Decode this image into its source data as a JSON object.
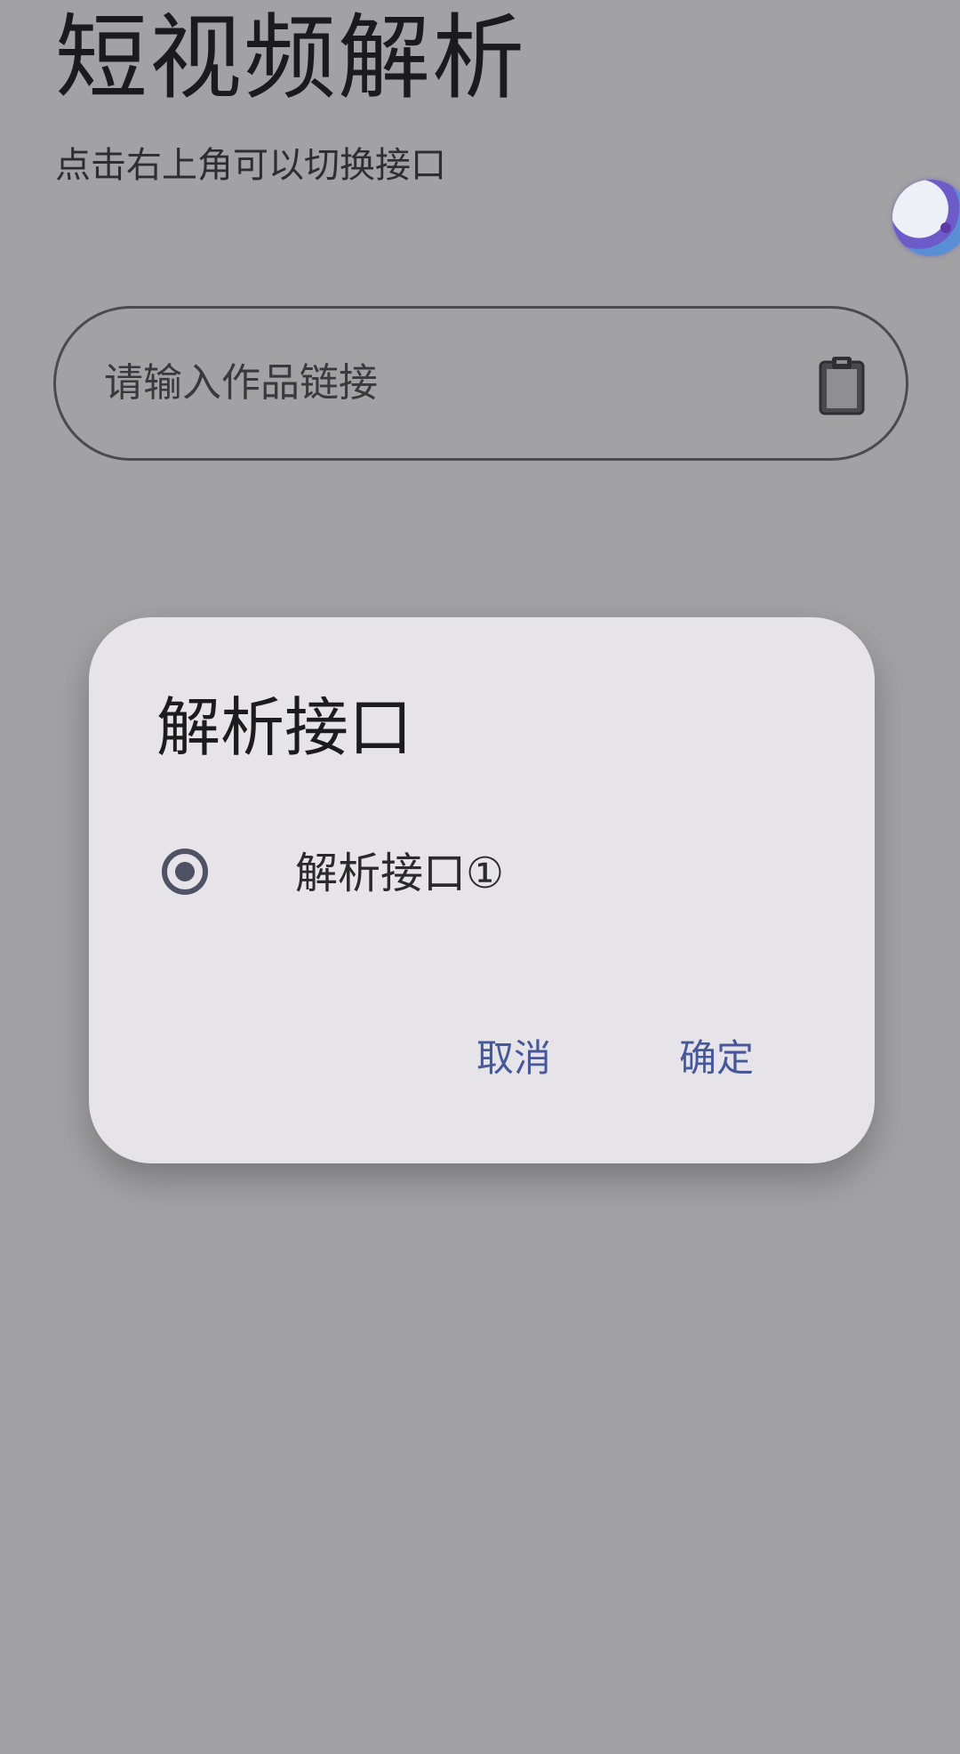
{
  "page": {
    "title": "短视频解析",
    "subtitle": "点击右上角可以切换接口"
  },
  "input": {
    "placeholder": "请输入作品链接"
  },
  "dialog": {
    "title": "解析接口",
    "options": [
      {
        "label": "解析接口①",
        "selected": true
      }
    ],
    "cancel_label": "取消",
    "confirm_label": "确定"
  },
  "colors": {
    "scrim": "#a2a2a5",
    "dialog_bg": "#e6e4e9",
    "accent": "#46589a",
    "radio": "#4f5264"
  },
  "icons": {
    "paste": "clipboard-icon",
    "floating": "floating-ball-icon"
  }
}
